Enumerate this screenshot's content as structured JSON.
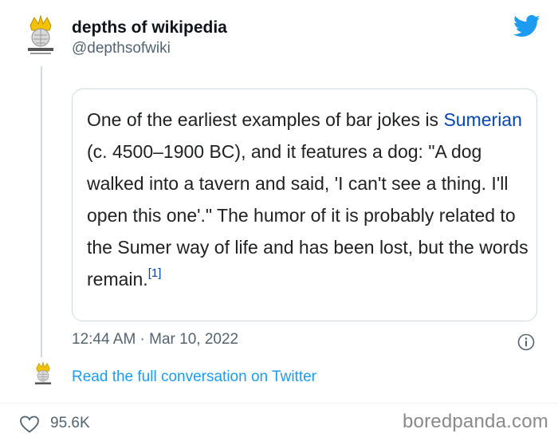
{
  "tweet": {
    "display_name": "depths of wikipedia",
    "handle": "@depthsofwiki",
    "quote": {
      "before_link": "One of the earliest examples of bar jokes is ",
      "link_text": "Sumerian",
      "after_link": " (c. 4500–1900 BC), and it features a dog: \"A dog walked into a tavern and said, 'I can't see a thing. I'll open this one'.\" The humor of it is probably related to the Sumer way of life and has been lost, but the words remain.",
      "citation": "[1]"
    },
    "timestamp": "12:44 AM · Mar 10, 2022",
    "read_more": "Read the full conversation on Twitter",
    "likes": "95.6K"
  },
  "avatar_logo_text": "Wikipedia",
  "watermark": "boredpanda.com",
  "colors": {
    "twitter_blue": "#1d9bf0",
    "wiki_link": "#0645ad",
    "secondary_text": "#536471"
  },
  "icons": [
    "wikipedia-avatar-icon",
    "twitter-bird-icon",
    "info-icon",
    "heart-icon"
  ]
}
